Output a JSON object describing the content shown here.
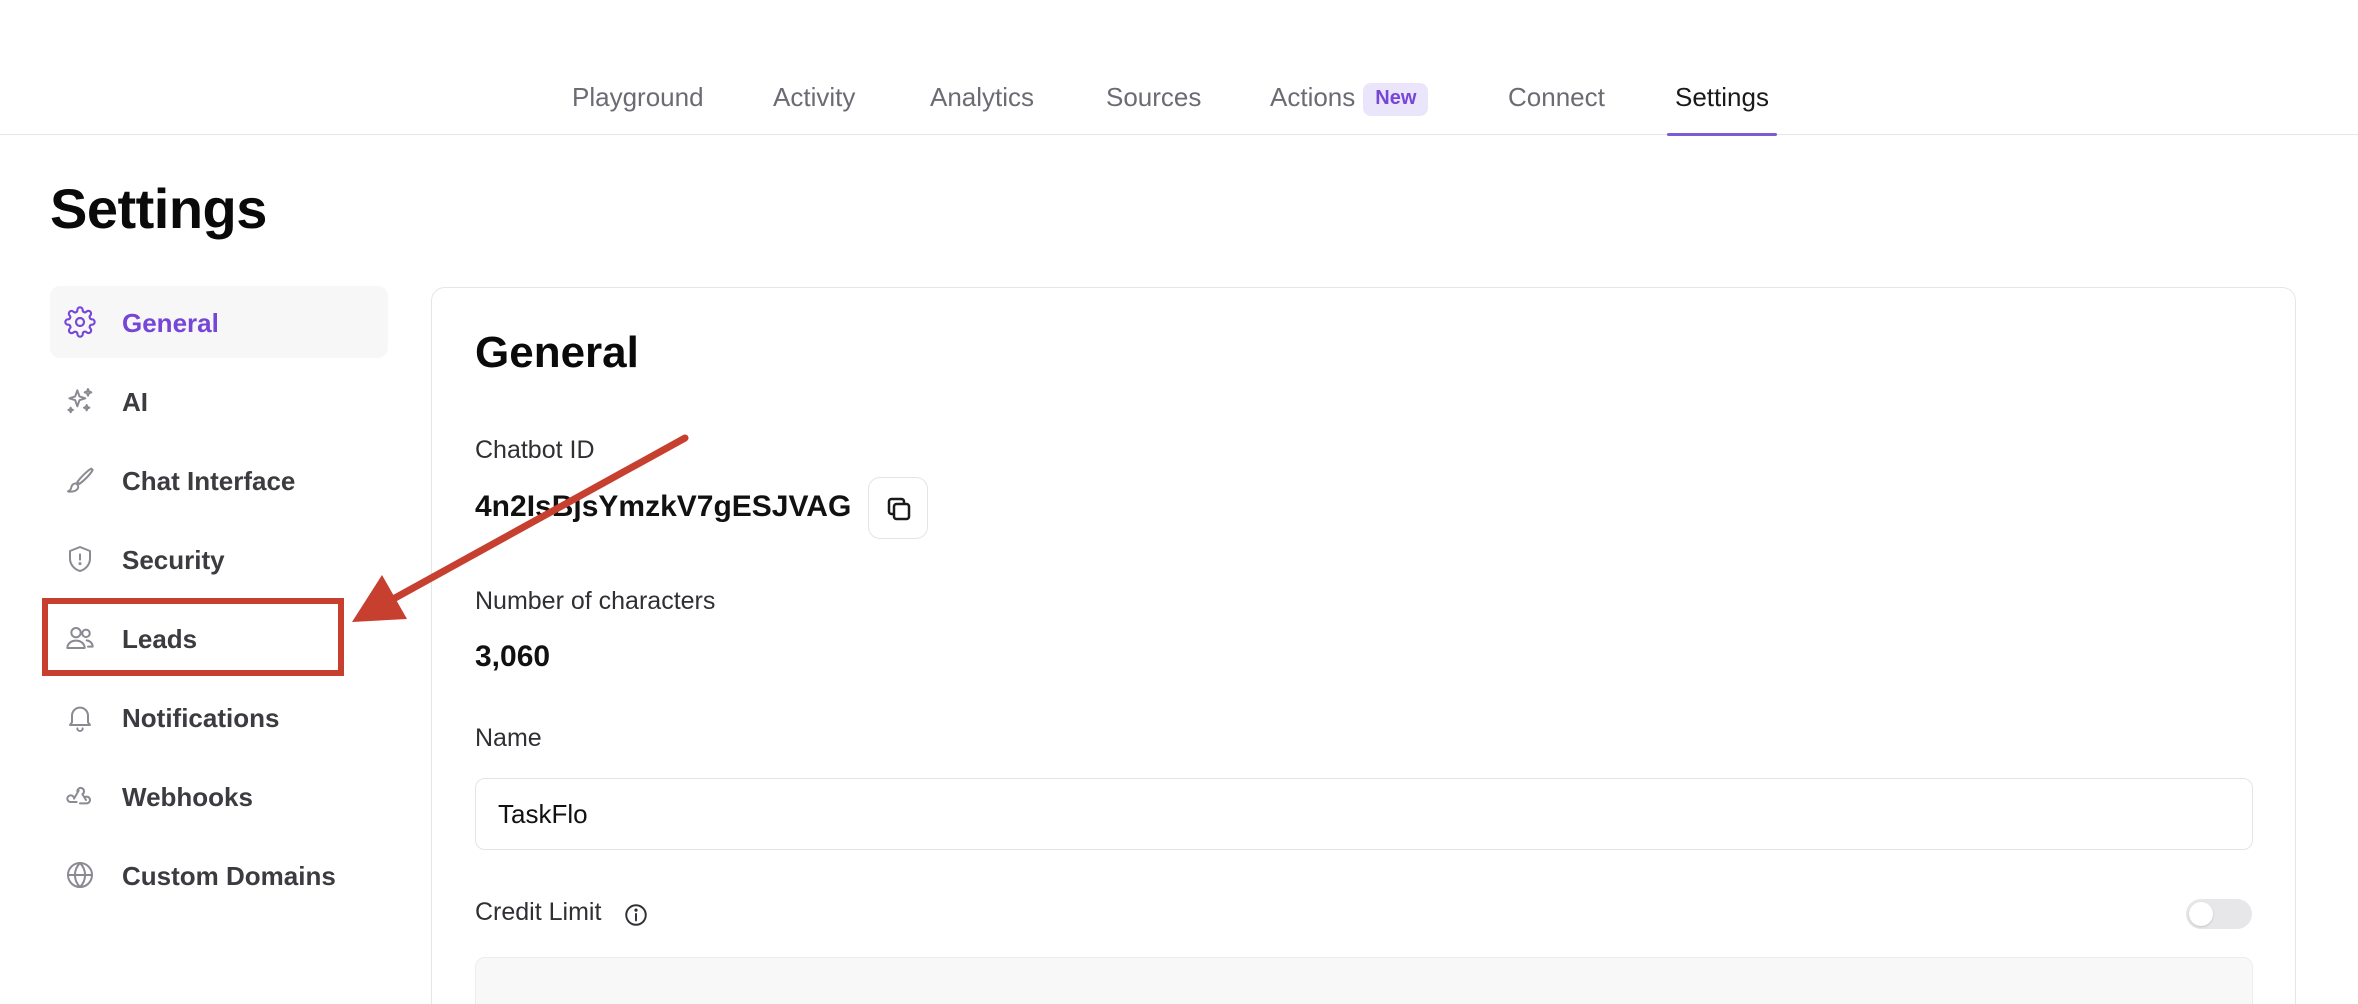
{
  "nav": {
    "tabs": [
      {
        "label": "Playground"
      },
      {
        "label": "Activity"
      },
      {
        "label": "Analytics"
      },
      {
        "label": "Sources"
      },
      {
        "label": "Actions",
        "badge": "New"
      },
      {
        "label": "Connect"
      },
      {
        "label": "Settings",
        "active": true
      }
    ]
  },
  "page": {
    "title": "Settings"
  },
  "sidebar": {
    "items": [
      {
        "label": "General",
        "icon": "gear-icon",
        "active": true
      },
      {
        "label": "AI",
        "icon": "sparkles-icon"
      },
      {
        "label": "Chat Interface",
        "icon": "brush-icon"
      },
      {
        "label": "Security",
        "icon": "shield-icon"
      },
      {
        "label": "Leads",
        "icon": "users-icon"
      },
      {
        "label": "Notifications",
        "icon": "bell-icon"
      },
      {
        "label": "Webhooks",
        "icon": "webhook-icon"
      },
      {
        "label": "Custom Domains",
        "icon": "globe-icon"
      }
    ]
  },
  "general": {
    "title": "General",
    "chatbot_id_label": "Chatbot ID",
    "chatbot_id": "4n2IsBjsYmzkV7gESJVAG",
    "characters_label": "Number of characters",
    "characters": "3,060",
    "name_label": "Name",
    "name_value": "TaskFlo",
    "credit_limit_label": "Credit Limit",
    "credit_limit_enabled": false
  },
  "colors": {
    "accent": "#7646d6",
    "annotation": "#c63f2f"
  }
}
